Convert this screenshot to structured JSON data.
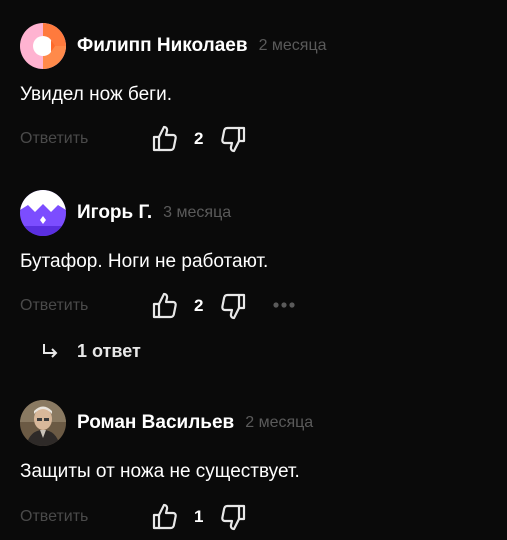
{
  "comments": [
    {
      "author": "Филипп Николаев",
      "time": "2 месяца",
      "text": "Увидел нож беги.",
      "reply_label": "Ответить",
      "likes": "2",
      "avatar_icon": "orange-pink-avatar-icon"
    },
    {
      "author": "Игорь Г.",
      "time": "3 месяца",
      "text": "Бутафор. Ноги не работают.",
      "reply_label": "Ответить",
      "likes": "2",
      "replies_label": "1 ответ",
      "avatar_icon": "purple-crown-avatar-icon"
    },
    {
      "author": "Роман Васильев",
      "time": "2 месяца",
      "text": "Защиты от ножа не существует.",
      "reply_label": "Ответить",
      "likes": "1",
      "avatar_icon": "user-photo-avatar"
    }
  ],
  "colors": {
    "background": "#0a0a0a",
    "text": "#ffffff",
    "muted": "#5a5a5a",
    "reply_link": "#4a4a4a"
  }
}
